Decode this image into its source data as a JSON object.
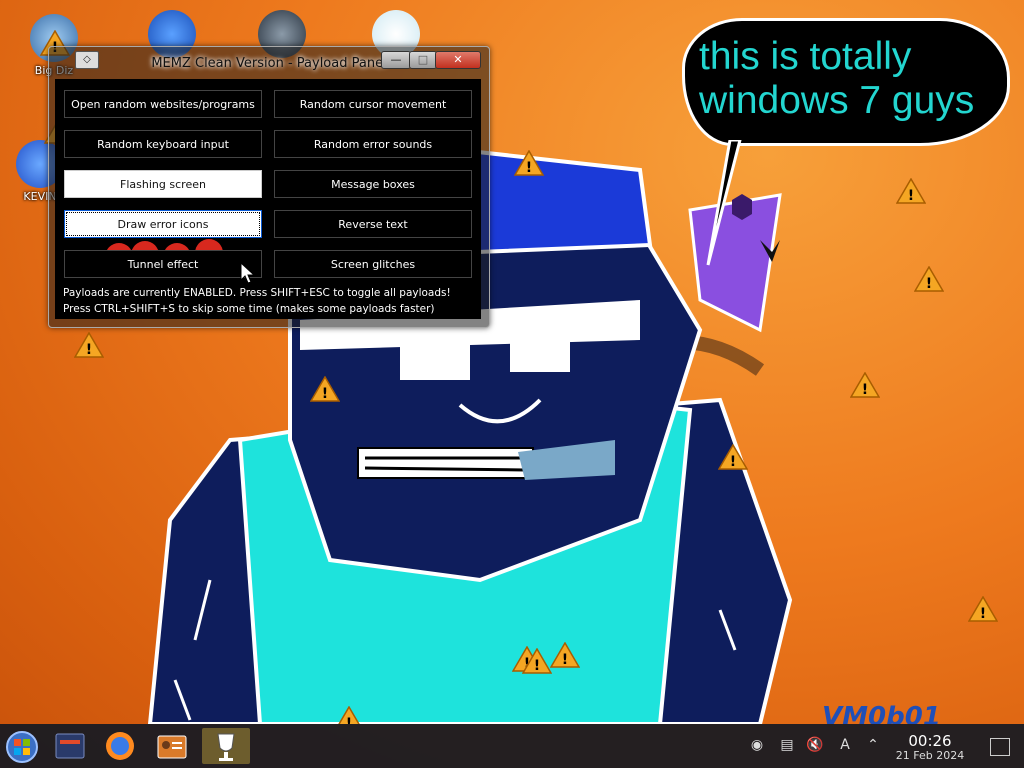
{
  "desktop": {
    "icons": [
      {
        "label": "Big Diz"
      },
      {
        "label": "KEVIN"
      }
    ],
    "speech_bubble": {
      "line1": "this is totally",
      "line2": "windows 7 guys"
    },
    "watermark": "VM0b01"
  },
  "window": {
    "title": "MEMZ Clean Version - Payload Panel",
    "system_menu_icon": "diamond-icon",
    "minimize_label": "—",
    "maximize_label": "□",
    "close_label": "✕",
    "payloads": [
      {
        "label": "Open random websites/programs",
        "enabled": false
      },
      {
        "label": "Random cursor movement",
        "enabled": false
      },
      {
        "label": "Random keyboard input",
        "enabled": false
      },
      {
        "label": "Random error sounds",
        "enabled": false
      },
      {
        "label": "Flashing screen",
        "enabled": true
      },
      {
        "label": "Message boxes",
        "enabled": false
      },
      {
        "label": "Draw error icons",
        "enabled": true
      },
      {
        "label": "Reverse text",
        "enabled": false
      },
      {
        "label": "Tunnel effect",
        "enabled": false
      },
      {
        "label": "Screen glitches",
        "enabled": false
      }
    ],
    "status_line1": "Payloads are currently ENABLED. Press SHIFT+ESC to toggle all payloads!",
    "status_line2": "Press CTRL+SHIFT+S to skip some time (makes some payloads faster)"
  },
  "taskbar": {
    "start_icon": "windows-orb-icon",
    "pinned": [
      "file-manager-icon",
      "firefox-icon",
      "control-panel-icon",
      "memz-icon"
    ],
    "tray": [
      "app-icon",
      "clipboard-icon",
      "mute-icon",
      "keyboard-layout-icon",
      "chevron-up-icon"
    ],
    "clock_time": "00:26",
    "clock_date": "21 Feb 2024"
  },
  "colors": {
    "wallpaper": "#ee7a1e",
    "bubble_text": "#23d6d0",
    "shirt": "#1ee3dc",
    "navy": "#0e1d5c",
    "warning": "#f5a623"
  }
}
